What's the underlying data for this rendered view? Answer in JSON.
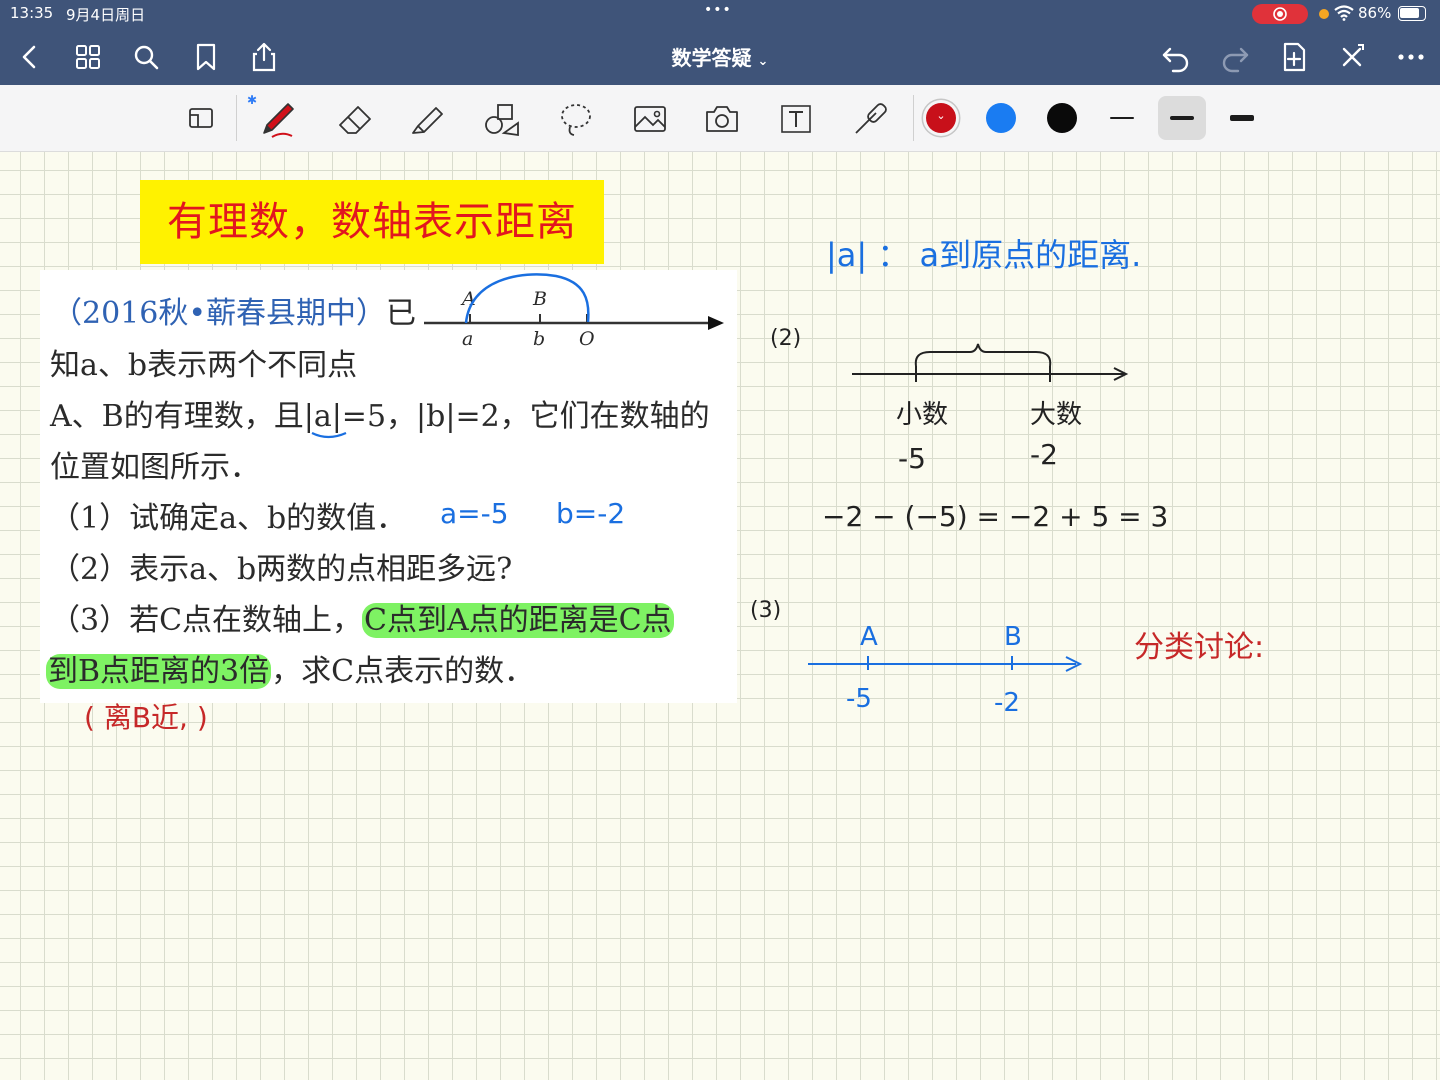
{
  "status_bar": {
    "time": "13:35",
    "date": "9月4日周日",
    "battery": "86%",
    "battery_level_percent": 86
  },
  "nav": {
    "title": "数学答疑",
    "icons": [
      "back-chevron-icon",
      "grid-icon",
      "search-icon",
      "bookmark-icon",
      "share-icon",
      "undo-icon",
      "redo-icon",
      "add-page-icon",
      "close-x-icon",
      "more-icon"
    ]
  },
  "toolbar": {
    "tools": [
      "lasso-select-icon",
      "pen-icon",
      "eraser-icon",
      "highlighter-icon",
      "shapes-icon",
      "lasso-icon",
      "image-icon",
      "camera-icon",
      "text-icon",
      "laser-pointer-icon"
    ],
    "colors": [
      "#c8101a",
      "#1a7cf2",
      "#0a0a0a"
    ],
    "selected_color": "#c8101a",
    "stroke_widths": [
      "thin",
      "medium",
      "thick"
    ],
    "selected_stroke": "medium"
  },
  "note": {
    "banner": "有理数，数轴表示距离",
    "question": {
      "source": "（2016秋•蕲春县期中）",
      "line1_tail": "已",
      "line2": "知a、b表示两个不同点",
      "line3": "A、B的有理数，且|a|=5，|b|=2，它们在数轴的",
      "line4": "位置如图所示．",
      "q1": "（1）试确定a、b的数值．",
      "q2": "（2）表示a、b两数的点相距多远?",
      "q3_pre": "（3）若C点在数轴上，",
      "q3_hl1": "C点到A点的距离是C点",
      "q3_hl2": "到B点距离的3倍",
      "q3_post": "，求C点表示的数．",
      "figure": {
        "label_A": "A",
        "label_B": "B",
        "label_a": "a",
        "label_b": "b",
        "label_O": "O"
      }
    },
    "handwriting": {
      "ans_a": "a=-5",
      "ans_b": "b=-2",
      "abs_def": "|a| ： a到原点的距离.",
      "p2_label": "(2)",
      "small_num": "小数",
      "big_num": "大数",
      "val_small": "-5",
      "val_big": "-2",
      "calc": "−2 − (−5) = −2 + 5 = 3",
      "p3_label": "(3)",
      "axis_A": "A",
      "axis_B": "B",
      "axis_m5": "-5",
      "axis_m2": "-2",
      "discuss": "分类讨论:",
      "red_note": "( 离B近,  )"
    }
  }
}
